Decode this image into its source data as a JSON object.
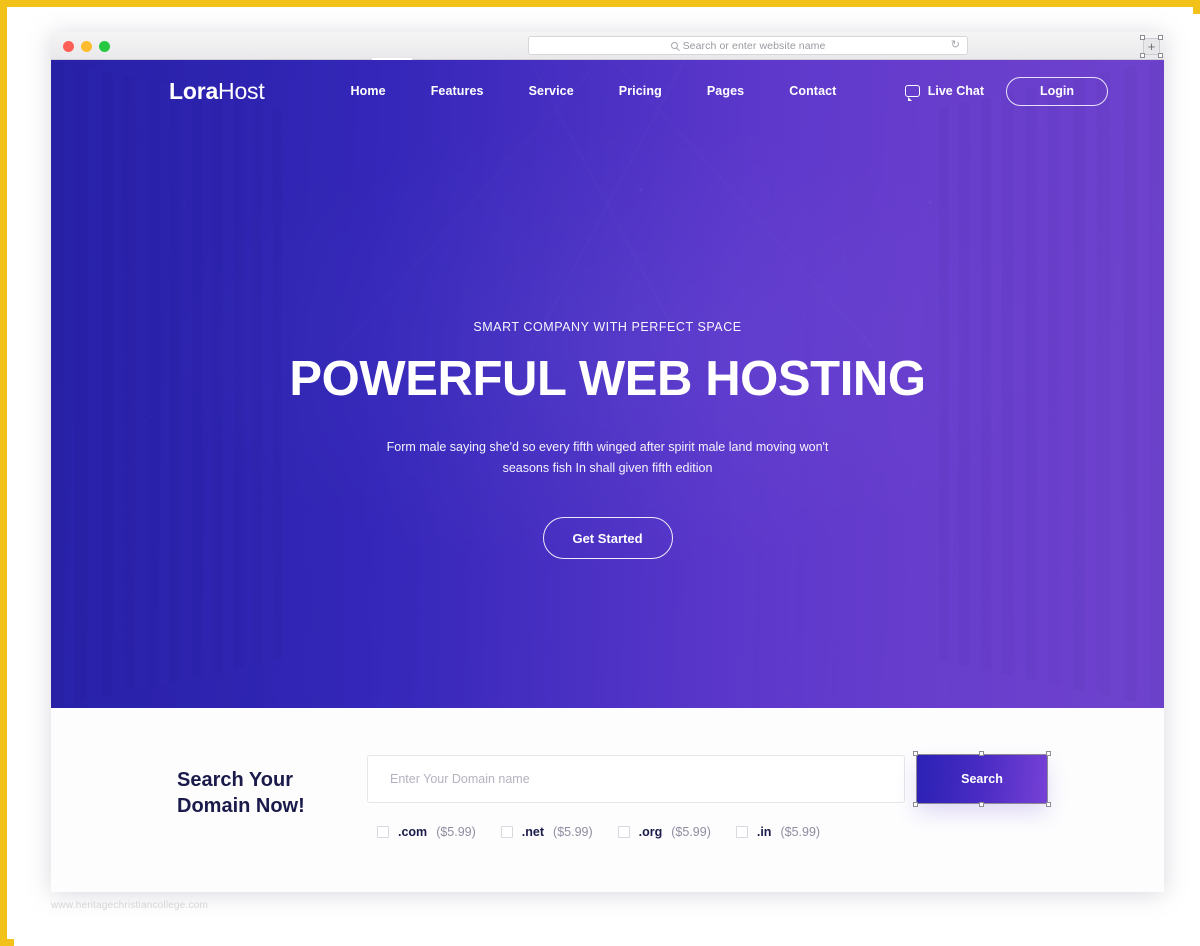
{
  "browser": {
    "address_placeholder": "Search or enter website name",
    "search_icon": "search-icon",
    "reload_icon": "reload-icon",
    "new_tab_label": "+",
    "traffic_lights": [
      "close",
      "minimize",
      "maximize"
    ]
  },
  "site": {
    "logo_bold": "Lora",
    "logo_light": "Host",
    "menu": [
      {
        "label": "Home"
      },
      {
        "label": "Features"
      },
      {
        "label": "Service"
      },
      {
        "label": "Pricing"
      },
      {
        "label": "Pages"
      },
      {
        "label": "Contact"
      }
    ],
    "live_chat": {
      "label": "Live Chat",
      "icon": "chat-bubble-icon"
    },
    "login_label": "Login"
  },
  "hero": {
    "eyebrow": "SMART COMPANY WITH PERFECT SPACE",
    "headline": "POWERFUL WEB HOSTING",
    "subtext_line1": "Form male saying she'd so every fifth winged after spirit male land moving won't",
    "subtext_line2": "seasons fish In shall given fifth edition",
    "cta_label": "Get Started"
  },
  "domain_search": {
    "title_line1": "Search Your",
    "title_line2": "Domain Now!",
    "input_placeholder": "Enter Your Domain name",
    "input_value": "",
    "button_label": "Search",
    "tlds": [
      {
        "name": ".com",
        "price": "($5.99)",
        "checked": false
      },
      {
        "name": ".net",
        "price": "($5.99)",
        "checked": false
      },
      {
        "name": ".org",
        "price": "($5.99)",
        "checked": false
      },
      {
        "name": ".in",
        "price": "($5.99)",
        "checked": false
      }
    ]
  },
  "watermark": "www.heritagechristiancollege.com",
  "colors": {
    "frame": "#f2c21b",
    "hero_blue": "#2b24a9",
    "hero_purple": "#6f43cd",
    "heading_navy": "#1b1b4b",
    "button_gradient_start": "#2b21b4",
    "button_gradient_end": "#7741d6"
  }
}
